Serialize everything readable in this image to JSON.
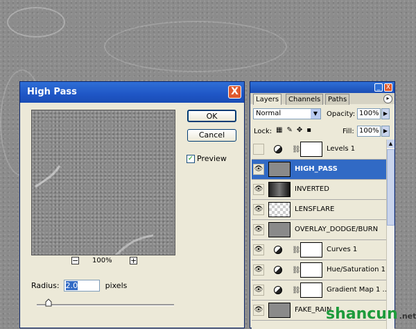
{
  "dialog": {
    "title": "High Pass",
    "close_label": "X",
    "ok_label": "OK",
    "cancel_label": "Cancel",
    "preview_label": "Preview",
    "preview_checked": true,
    "zoom_minus": "−",
    "zoom_plus": "+",
    "zoom_level": "100%",
    "radius_label": "Radius:",
    "radius_value": "2.0",
    "radius_unit": "pixels"
  },
  "panel": {
    "minimize_label": "_",
    "close_label": "X",
    "tabs": [
      "Layers",
      "Channels",
      "Paths"
    ],
    "active_tab": "Layers",
    "blend_mode": "Normal",
    "opacity_label": "Opacity:",
    "opacity_value": "100%",
    "lock_label": "Lock:",
    "fill_label": "Fill:",
    "fill_value": "100%",
    "layers": [
      {
        "name": "Levels 1",
        "visible": false,
        "adjustment": true,
        "selected": false
      },
      {
        "name": "HIGH_PASS",
        "visible": true,
        "adjustment": false,
        "selected": true
      },
      {
        "name": "INVERTED",
        "visible": true,
        "adjustment": false,
        "selected": false
      },
      {
        "name": "LENSFLARE",
        "visible": true,
        "adjustment": false,
        "selected": false
      },
      {
        "name": "OVERLAY_DODGE/BURN",
        "visible": true,
        "adjustment": false,
        "selected": false
      },
      {
        "name": "Curves 1",
        "visible": true,
        "adjustment": true,
        "selected": false
      },
      {
        "name": "Hue/Saturation 1",
        "visible": true,
        "adjustment": true,
        "selected": false
      },
      {
        "name": "Gradient Map 1 ...",
        "visible": true,
        "adjustment": true,
        "selected": false
      },
      {
        "name": "FAKE_RAIN",
        "visible": true,
        "adjustment": false,
        "selected": false
      }
    ]
  },
  "watermark": {
    "brand": "shancun",
    "suffix": ".net"
  },
  "colors": {
    "titlebar": "#1f56c6",
    "selection": "#316ac5",
    "dialog_bg": "#ece9d8"
  }
}
